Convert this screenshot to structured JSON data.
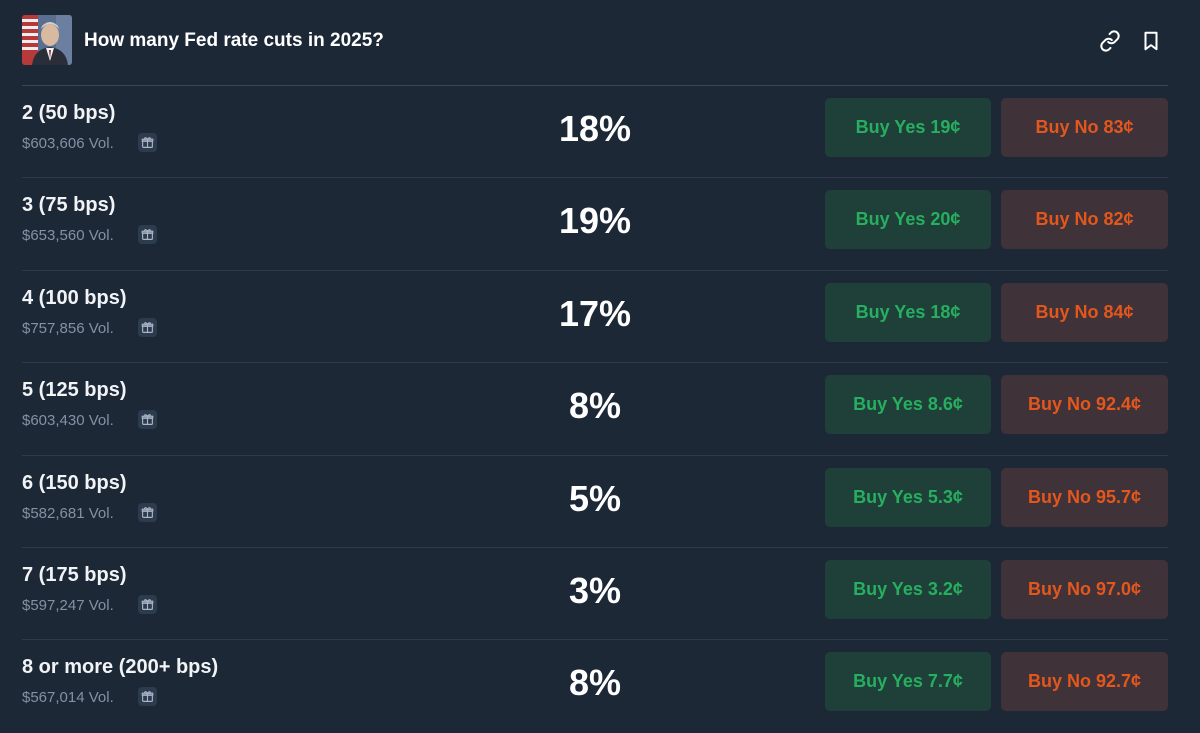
{
  "header": {
    "title": "How many Fed rate cuts in 2025?",
    "icons": [
      "link-icon",
      "bookmark-icon"
    ]
  },
  "colors": {
    "background": "#1d2837",
    "yes_bg": "#1e4039",
    "yes_text": "#27ae60",
    "no_bg": "#3f3239",
    "no_text": "#e4571c",
    "muted_text": "#8391a3"
  },
  "outcomes": [
    {
      "label": "2 (50 bps)",
      "volume": "$603,606 Vol.",
      "probability": "18%",
      "buy_yes": "Buy Yes 19¢",
      "buy_no": "Buy No 83¢"
    },
    {
      "label": "3 (75 bps)",
      "volume": "$653,560 Vol.",
      "probability": "19%",
      "buy_yes": "Buy Yes 20¢",
      "buy_no": "Buy No 82¢"
    },
    {
      "label": "4 (100 bps)",
      "volume": "$757,856 Vol.",
      "probability": "17%",
      "buy_yes": "Buy Yes 18¢",
      "buy_no": "Buy No 84¢"
    },
    {
      "label": "5 (125 bps)",
      "volume": "$603,430 Vol.",
      "probability": "8%",
      "buy_yes": "Buy Yes 8.6¢",
      "buy_no": "Buy No 92.4¢"
    },
    {
      "label": "6 (150 bps)",
      "volume": "$582,681 Vol.",
      "probability": "5%",
      "buy_yes": "Buy Yes 5.3¢",
      "buy_no": "Buy No 95.7¢"
    },
    {
      "label": "7 (175 bps)",
      "volume": "$597,247 Vol.",
      "probability": "3%",
      "buy_yes": "Buy Yes 3.2¢",
      "buy_no": "Buy No 97.0¢"
    },
    {
      "label": "8 or more (200+ bps)",
      "volume": "$567,014 Vol.",
      "probability": "8%",
      "buy_yes": "Buy Yes 7.7¢",
      "buy_no": "Buy No 92.7¢"
    }
  ]
}
